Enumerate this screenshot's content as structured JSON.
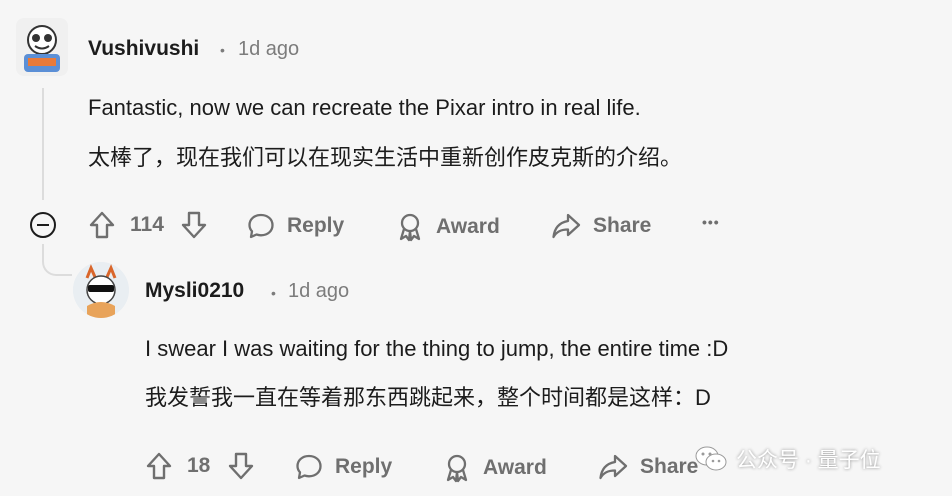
{
  "comments": [
    {
      "username": "Vushivushi",
      "time": "1d ago",
      "lines": [
        "Fantastic, now we can recreate the Pixar intro in real life.",
        "太棒了，现在我们可以在现实生活中重新创作皮克斯的介绍。"
      ],
      "votes": "114",
      "reply_label": "Reply",
      "award_label": "Award",
      "share_label": "Share",
      "more_label": "•••"
    },
    {
      "username": "Mysli0210",
      "time": "1d ago",
      "lines": [
        "I swear I was waiting for the thing to jump, the entire time :D",
        "我发誓我一直在等着那东西跳起来，整个时间都是这样：D"
      ],
      "votes": "18",
      "reply_label": "Reply",
      "award_label": "Award",
      "share_label": "Share"
    }
  ],
  "meta_separator": "•",
  "watermark": {
    "text": "公众号 · 量子位"
  }
}
